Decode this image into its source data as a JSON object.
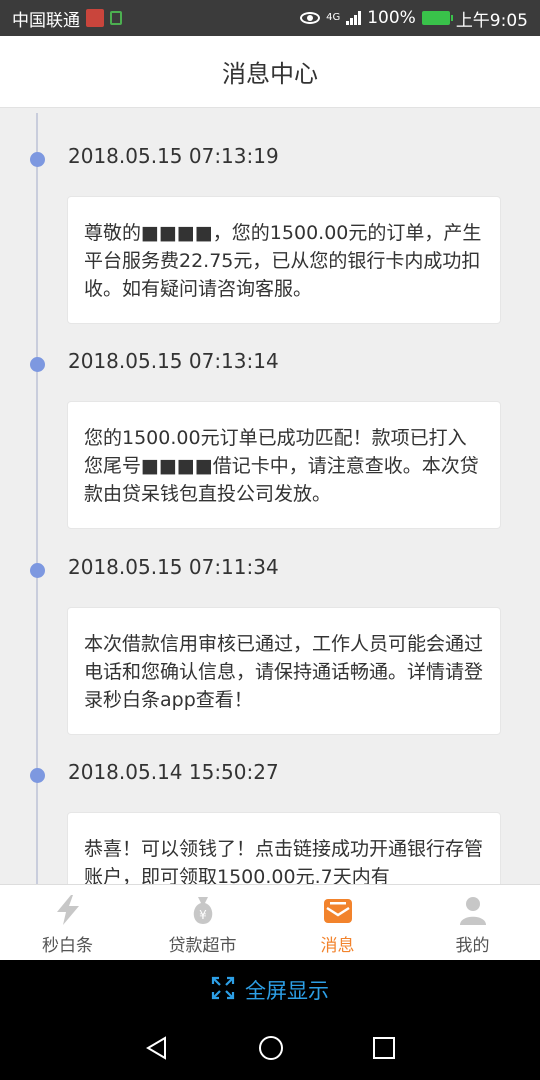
{
  "status_bar": {
    "carrier": "中国联通",
    "network": "4G",
    "battery": "100%",
    "time": "上午9:05"
  },
  "header": {
    "title": "消息中心"
  },
  "messages": [
    {
      "time": "2018.05.15 07:13:19",
      "text": "尊敬的■■■■，您的1500.00元的订单，产生平台服务费22.75元，已从您的银行卡内成功扣收。如有疑问请咨询客服。"
    },
    {
      "time": "2018.05.15 07:13:14",
      "text": "您的1500.00元订单已成功匹配！款项已打入您尾号■■■■借记卡中，请注意查收。本次贷款由贷呆钱包直投公司发放。"
    },
    {
      "time": "2018.05.15 07:11:34",
      "text": "本次借款信用审核已通过，工作人员可能会通过电话和您确认信息，请保持通话畅通。详情请登录秒白条app查看！"
    },
    {
      "time": "2018.05.14 15:50:27",
      "text": "恭喜！可以领钱了！点击链接成功开通银行存管账户，即可领取1500.00元.7天内有"
    }
  ],
  "tabs": [
    {
      "label": "秒白条",
      "icon": "lightning-icon",
      "active": false
    },
    {
      "label": "贷款超市",
      "icon": "money-bag-icon",
      "active": false
    },
    {
      "label": "消息",
      "icon": "message-envelope-icon",
      "active": true
    },
    {
      "label": "我的",
      "icon": "user-profile-icon",
      "active": false
    }
  ],
  "fullscreen": {
    "label": "全屏显示"
  },
  "colors": {
    "accent": "#f2832c",
    "timeline_dot": "#7d98e0",
    "fullscreen_text": "#2d9fe6"
  }
}
